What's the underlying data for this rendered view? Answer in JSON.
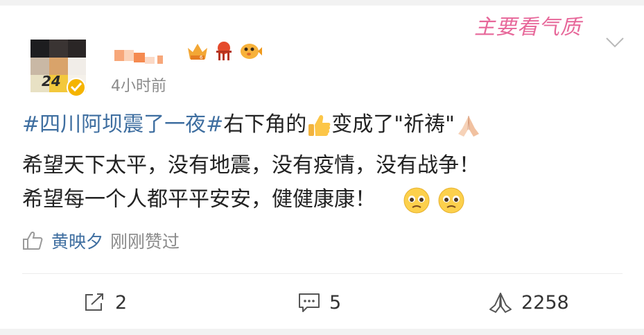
{
  "post": {
    "time": "4小时前",
    "watermark": "主要看气质",
    "text": {
      "hashtag": "#四川阿坝震了一夜#",
      "line1_after_hashtag": "右下角的",
      "line1_middle": "变成了\"祈祷\"",
      "line2": "希望天下太平，没有地震，没有疫情，没有战争！",
      "line3": "希望每一个人都平平安安，健健康康！"
    },
    "liked_by": {
      "name": "黄映夕",
      "time": "刚刚赞过"
    }
  },
  "actions": {
    "repost_count": "2",
    "comment_count": "5",
    "like_count": "2258"
  },
  "icons": {
    "thumbs_up_emoji": "thumbs-up-emoji",
    "pray_emoji": "pray-emoji",
    "pleading_emoji": "pleading-face-emoji",
    "like_outline": "thumbs-up-outline-icon",
    "repost": "share-icon",
    "comment": "comment-icon",
    "like": "like-hands-icon"
  },
  "colors": {
    "hashtag": "#3e6ea0",
    "watermark": "#e7689a",
    "secondary_text": "#8a8a8a",
    "verified_badge": "#f5b400"
  }
}
